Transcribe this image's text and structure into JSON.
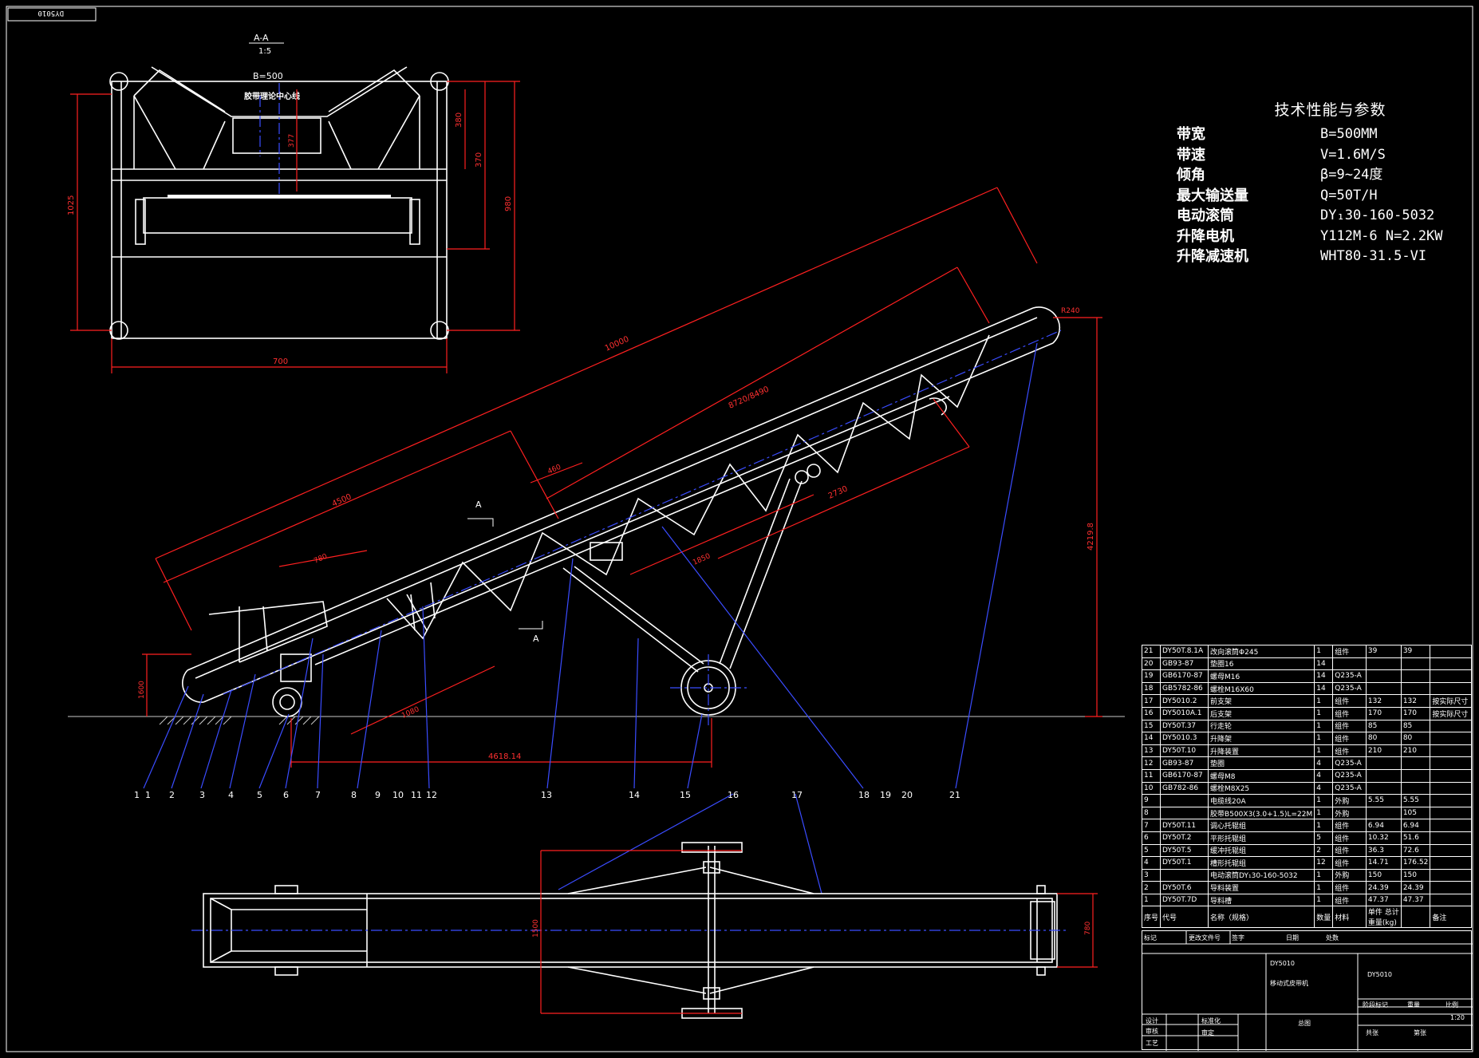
{
  "sheet": {
    "code_stamp": "DY5010"
  },
  "section": {
    "label": "A-A",
    "scale": "1:5",
    "belt_width": "B=500",
    "center_label": "胶带理论中心线",
    "dims": [
      "700",
      "1025",
      "980",
      "370",
      "380",
      "377"
    ]
  },
  "specs": {
    "title": "技术性能与参数",
    "rows": [
      {
        "key": "带宽",
        "value": "B=500MM"
      },
      {
        "key": "带速",
        "value": "V=1.6M/S"
      },
      {
        "key": "倾角",
        "value": "β=9~24度"
      },
      {
        "key": "最大输送量",
        "value": "Q=50T/H"
      },
      {
        "key": "电动滚筒",
        "value": "DY₁30-160-5032"
      },
      {
        "key": "升降电机",
        "value": "Y112M-6 N=2.2KW"
      },
      {
        "key": "升降减速机",
        "value": "WHT80-31.5-VI"
      }
    ]
  },
  "main_view": {
    "section_marks": [
      "A",
      "A"
    ],
    "dims": [
      "10000",
      "8720/8490",
      "4500",
      "2730",
      "460",
      "780",
      "1850",
      "4618.14",
      "4219.8",
      "1600",
      "1080",
      "R240"
    ],
    "callouts": [
      "1",
      "1",
      "2",
      "3",
      "4",
      "5",
      "6",
      "7",
      "8",
      "9",
      "10",
      "11",
      "12",
      "13",
      "14",
      "15",
      "16",
      "17",
      "18",
      "19",
      "20",
      "21"
    ]
  },
  "plan_view": {
    "dims": [
      "780",
      "1500"
    ]
  },
  "bom": {
    "rows": [
      [
        "21",
        "DY50T.8.1A",
        "改向滚筒Φ245",
        "1",
        "组件",
        "39",
        "39",
        ""
      ],
      [
        "20",
        "GB93-87",
        "垫圈16",
        "14",
        "",
        "",
        "",
        ""
      ],
      [
        "19",
        "GB6170-87",
        "螺母M16",
        "14",
        "Q235-A",
        "",
        "",
        ""
      ],
      [
        "18",
        "GB5782-86",
        "螺栓M16X60",
        "14",
        "Q235-A",
        "",
        "",
        ""
      ],
      [
        "17",
        "DY5010.2",
        "前支架",
        "1",
        "组件",
        "132",
        "132",
        "按实际尺寸"
      ],
      [
        "16",
        "DY5010A.1",
        "后支架",
        "1",
        "组件",
        "170",
        "170",
        "按实际尺寸"
      ],
      [
        "15",
        "DY50T.37",
        "行走轮",
        "1",
        "组件",
        "85",
        "85",
        ""
      ],
      [
        "14",
        "DY5010.3",
        "升降架",
        "1",
        "组件",
        "80",
        "80",
        ""
      ],
      [
        "13",
        "DY50T.10",
        "升降装置",
        "1",
        "组件",
        "210",
        "210",
        ""
      ],
      [
        "12",
        "GB93-87",
        "垫圈",
        "4",
        "Q235-A",
        "",
        "",
        ""
      ],
      [
        "11",
        "GB6170-87",
        "螺母M8",
        "4",
        "Q235-A",
        "",
        "",
        ""
      ],
      [
        "10",
        "GB782-86",
        "螺栓M8X25",
        "4",
        "Q235-A",
        "",
        "",
        ""
      ],
      [
        "9",
        "",
        "电缆线20A",
        "1",
        "外购",
        "5.55",
        "5.55",
        ""
      ],
      [
        "8",
        "",
        "胶带B500X3(3.0+1.5)L=22M",
        "1",
        "外购",
        "",
        "105",
        ""
      ],
      [
        "7",
        "DY50T.11",
        "调心托辊组",
        "1",
        "组件",
        "6.94",
        "6.94",
        ""
      ],
      [
        "6",
        "DY50T.2",
        "平形托辊组",
        "5",
        "组件",
        "10.32",
        "51.6",
        ""
      ],
      [
        "5",
        "DY50T.5",
        "缓冲托辊组",
        "2",
        "组件",
        "36.3",
        "72.6",
        ""
      ],
      [
        "4",
        "DY50T.1",
        "槽形托辊组",
        "12",
        "组件",
        "14.71",
        "176.52",
        ""
      ],
      [
        "3",
        "",
        "电动滚筒DY₁30-160-5032",
        "1",
        "外购",
        "150",
        "150",
        ""
      ],
      [
        "2",
        "DY50T.6",
        "导料装置",
        "1",
        "组件",
        "24.39",
        "24.39",
        ""
      ],
      [
        "1",
        "DY50T.7D",
        "导料槽",
        "1",
        "组件",
        "47.37",
        "47.37",
        ""
      ]
    ],
    "header": [
      "序号",
      "代号",
      "名称（规格）",
      "数量",
      "材料",
      "单件",
      "总计",
      "备注"
    ],
    "weight_unit": "重量(kg)"
  },
  "title_block": {
    "code_a": "DY5010",
    "code_b": "DY5010",
    "name": "移动式皮带机",
    "view": "总图",
    "scale": "1:20",
    "stage_label": "阶段标记",
    "weight_label": "重量",
    "ratio_label": "比例",
    "sheet_total": "共张",
    "sheet_no": "第张",
    "mark_label": "标记",
    "count_label": "处数",
    "file_label": "更改文件号",
    "sign_label": "签字",
    "date_label": "日期",
    "roles": [
      "设计",
      "审核",
      "工艺"
    ],
    "std_label": "标准化",
    "approve_label": "审定"
  }
}
